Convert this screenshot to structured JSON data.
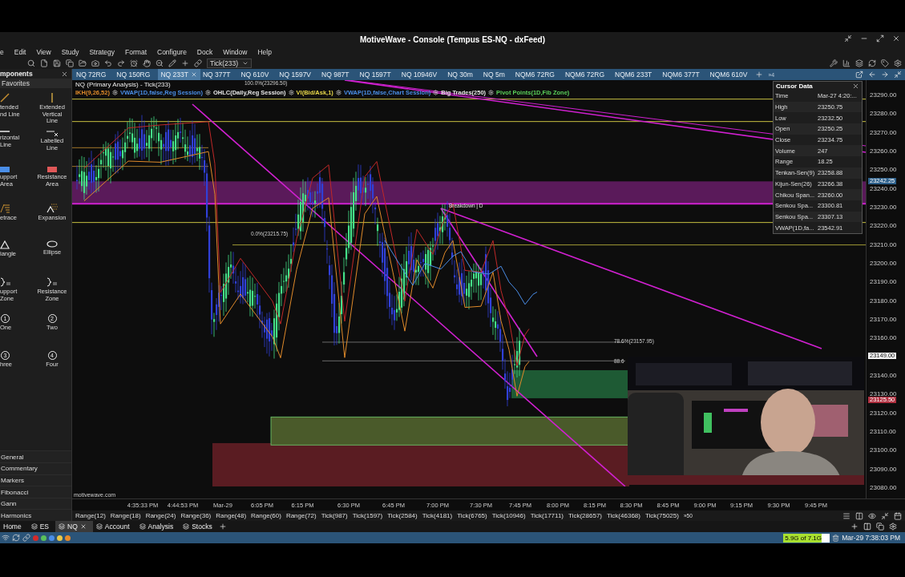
{
  "window": {
    "title": "MotiveWave - Console (Tempus ES-NQ - dxFeed)"
  },
  "menu": [
    "e",
    "Edit",
    "View",
    "Study",
    "Strategy",
    "Format",
    "Configure",
    "Dock",
    "Window",
    "Help"
  ],
  "toolbar": {
    "bar_size": "Tick(233)"
  },
  "components_panel": {
    "title": "mponents",
    "section": "Favorites",
    "tools": [
      {
        "kind": "trend-line",
        "label": "tended\nnd Line"
      },
      {
        "kind": "vertical-line",
        "label": "Extended\nVertical\nLine"
      },
      {
        "kind": "horizontal-line",
        "label": "rizontal\nLine"
      },
      {
        "kind": "labelled-line",
        "label": "Labelled\nLine"
      },
      {
        "kind": "support-area",
        "label": "upport\nArea"
      },
      {
        "kind": "resistance-area",
        "label": "Resistance\nArea"
      },
      {
        "kind": "retrace",
        "label": "etrace"
      },
      {
        "kind": "expansion",
        "label": "Expansion"
      },
      {
        "kind": "triangle",
        "label": "iangle"
      },
      {
        "kind": "ellipse",
        "label": "Ellipse"
      },
      {
        "kind": "support-zone",
        "label": "upport\nZone"
      },
      {
        "kind": "resistance-zone",
        "label": "Resistance\nZone"
      },
      {
        "kind": "number",
        "symbol": "1",
        "label": "One"
      },
      {
        "kind": "number",
        "symbol": "2",
        "label": "Two"
      },
      {
        "kind": "number",
        "symbol": "3",
        "label": "hree"
      },
      {
        "kind": "number",
        "symbol": "4",
        "label": "Four"
      }
    ],
    "categories": [
      "General",
      "Commentary",
      "Markers",
      "Fibonacci",
      "Gann",
      "Harmonics"
    ]
  },
  "chart_tabs": [
    {
      "label": "NQ 72RG",
      "selected": false
    },
    {
      "label": "NQ 150RG",
      "selected": false
    },
    {
      "label": "NQ 233T",
      "selected": true
    },
    {
      "label": "NQ 377T",
      "selected": false
    },
    {
      "label": "NQ 610V",
      "selected": false
    },
    {
      "label": "NQ 1597V",
      "selected": false
    },
    {
      "label": "NQ 987T",
      "selected": false
    },
    {
      "label": "NQ 1597T",
      "selected": false
    },
    {
      "label": "NQ 10946V",
      "selected": false
    },
    {
      "label": "NQ 30m",
      "selected": false
    },
    {
      "label": "NQ 5m",
      "selected": false
    },
    {
      "label": "NQM6 72RG",
      "selected": false
    },
    {
      "label": "NQM6 72RG",
      "selected": false
    },
    {
      "label": "NQM6 233T",
      "selected": false
    },
    {
      "label": "NQM6 377T",
      "selected": false
    },
    {
      "label": "NQM6 610V",
      "selected": false
    }
  ],
  "chart_tabs_more": "»4",
  "chart": {
    "title": "NQ (Primary Analysis) - Tick(233)",
    "studies": [
      {
        "label": "IKH(9,26,52)",
        "color": "#e08a2a"
      },
      {
        "label": "VWAP(1D,false,Reg Session)",
        "color": "#4a8ee8"
      },
      {
        "label": "OHLC(Daily,Reg Session)",
        "color": "#e8e8e8"
      },
      {
        "label": "VI(Bid/Ask,1)",
        "color": "#e8d84a"
      },
      {
        "label": "VWAP(1D,false,Chart Session)",
        "color": "#4a8ee8"
      },
      {
        "label": "Big Trades(250)",
        "color": "#e8e8e8"
      },
      {
        "label": "Pivot Points(1D,Fib Zone)",
        "color": "#5ad05a"
      }
    ],
    "annotations": [
      {
        "kind": "fib",
        "text": "100.0%(23296.50)"
      },
      {
        "kind": "note",
        "text": "Breakdown | D"
      },
      {
        "kind": "fib",
        "text": "0.0%(23215.75)"
      },
      {
        "kind": "fib",
        "text": "78.6%(23157.95)"
      },
      {
        "kind": "fib",
        "text": "88.6"
      }
    ],
    "watermark_text": "motivewave.com",
    "price_labels": [
      "23290.00",
      "23280.00",
      "23270.00",
      "23260.00",
      "23250.00",
      "23240.00",
      "23230.00",
      "23220.00",
      "23210.00",
      "23200.00",
      "23190.00",
      "23180.00",
      "23170.00",
      "23160.00",
      "23140.00",
      "23130.00",
      "23120.00",
      "23110.00",
      "23100.00",
      "23090.00",
      "23080.00"
    ],
    "price_markers": [
      {
        "text": "23242.25",
        "color": "#2c5f8a"
      },
      {
        "text": "23149.00",
        "color": "#f2f2f2"
      },
      {
        "text": "23125.50",
        "color": "#b03040"
      }
    ],
    "time_labels": [
      "4:35:33 PM",
      "4:44:53 PM",
      "Mar-29",
      "6:05 PM",
      "6:15 PM",
      "6:30 PM",
      "6:45 PM",
      "7:00 PM",
      "7:30 PM",
      "7:45 PM",
      "8:00 PM",
      "8:15 PM",
      "8:30 PM",
      "8:45 PM",
      "9:00 PM",
      "9:15 PM",
      "9:30 PM",
      "9:45 PM"
    ]
  },
  "cursor_data": {
    "title": "Cursor Data",
    "rows": [
      {
        "label": "Time",
        "value": "Mar-27 4:20:..."
      },
      {
        "label": "High",
        "value": "23250.75"
      },
      {
        "label": "Low",
        "value": "23232.50"
      },
      {
        "label": "Open",
        "value": "23250.25"
      },
      {
        "label": "Close",
        "value": "23234.75"
      },
      {
        "label": "Volume",
        "value": "247"
      },
      {
        "label": "Range",
        "value": "18.25"
      },
      {
        "label": "Tenkan-Sen(9)",
        "value": "23258.88"
      },
      {
        "label": "Kijun-Sen(26)",
        "value": "23266.38"
      },
      {
        "label": "Chikou Span...",
        "value": "23260.00"
      },
      {
        "label": "Senkou Spa...",
        "value": "23300.81"
      },
      {
        "label": "Senkou Spa...",
        "value": "23307.13"
      },
      {
        "label": "VWAP(1D,fa...",
        "value": "23542.91"
      }
    ]
  },
  "webcam": {
    "kind": "picture"
  },
  "bar_sizes": [
    "Range(12)",
    "Range(18)",
    "Range(24)",
    "Range(36)",
    "Range(48)",
    "Range(60)",
    "Range(72)",
    "Tick(987)",
    "Tick(1597)",
    "Tick(2584)",
    "Tick(4181)",
    "Tick(6765)",
    "Tick(10946)",
    "Tick(17711)",
    "Tick(28657)",
    "Tick(46368)",
    "Tick(75025)"
  ],
  "bar_sizes_more": "»50",
  "workspace_tabs": [
    {
      "label": "Home",
      "selected": false
    },
    {
      "label": "ES",
      "selected": false
    },
    {
      "label": "NQ",
      "selected": true
    },
    {
      "label": "Account",
      "selected": false
    },
    {
      "label": "Analysis",
      "selected": false
    },
    {
      "label": "Stocks",
      "selected": false
    }
  ],
  "status_bar": {
    "dots": [
      {
        "color": "#d42a2a"
      },
      {
        "color": "#5ac05a"
      },
      {
        "color": "#4a8ee8"
      },
      {
        "color": "#e8c84a"
      },
      {
        "color": "#e88a2a"
      }
    ],
    "memory": {
      "text": "5.9G of 7.1G",
      "level": 0.83
    },
    "datetime": "Mar-29 7:38:03 PM"
  }
}
